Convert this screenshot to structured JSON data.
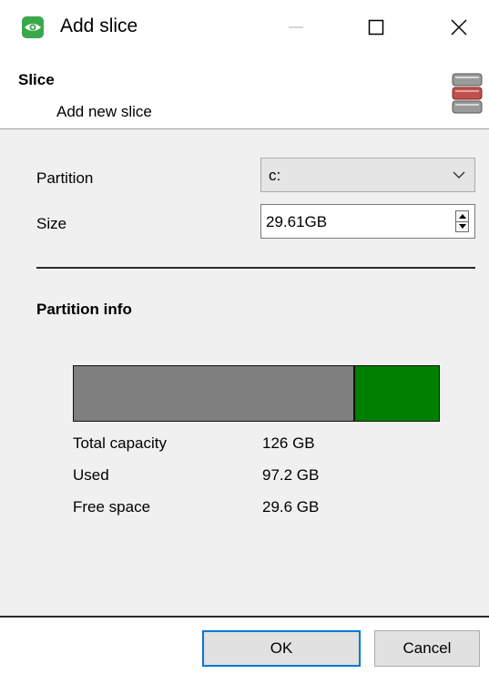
{
  "window": {
    "title": "Add slice",
    "app_icon": "eye-icon",
    "controls": [
      "minimize-icon",
      "maximize-icon",
      "close-icon"
    ]
  },
  "header": {
    "title": "Slice",
    "subtitle": "Add new slice",
    "icon": "database-stack-icon"
  },
  "form": {
    "partition_label": "Partition",
    "partition_value": "c:",
    "size_label": "Size",
    "size_value": "29.61GB"
  },
  "partition_info": {
    "title": "Partition info",
    "used_fraction": 0.771,
    "colors": {
      "used": "#7f7f7f",
      "free": "#008000"
    },
    "rows": [
      {
        "label": "Total capacity",
        "value": "126 GB"
      },
      {
        "label": "Used",
        "value": "97.2 GB"
      },
      {
        "label": "Free space",
        "value": "29.6 GB"
      }
    ]
  },
  "buttons": {
    "ok": "OK",
    "cancel": "Cancel"
  },
  "colors": {
    "accent": "#0078d7",
    "app_icon_bg": "#3aa84a",
    "panel_bg": "#f0f0f0"
  }
}
